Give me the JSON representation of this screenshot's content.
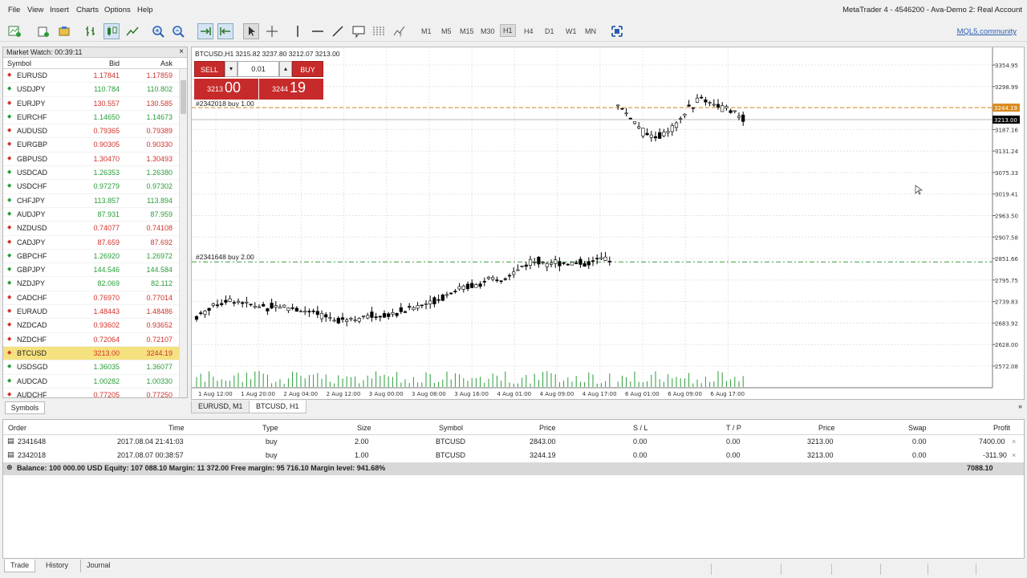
{
  "window_title": "MetaTrader 4 - 4546200 - Ava-Demo 2: Real Account",
  "menu": [
    "File",
    "View",
    "Insert",
    "Charts",
    "Options",
    "Help"
  ],
  "toolbar": {
    "timeframes": [
      "M1",
      "M5",
      "M15",
      "M30",
      "H1",
      "H4",
      "D1",
      "W1",
      "MN"
    ],
    "active_timeframe": "H1",
    "community_link": "MQL5.community"
  },
  "market_watch": {
    "title": "Market Watch: 00:39:11",
    "columns": {
      "symbol": "Symbol",
      "bid": "Bid",
      "ask": "Ask"
    },
    "rows": [
      {
        "symbol": "EURUSD",
        "bid": "1.17841",
        "ask": "1.17859",
        "dir": "down"
      },
      {
        "symbol": "USDJPY",
        "bid": "110.784",
        "ask": "110.802",
        "dir": "up"
      },
      {
        "symbol": "EURJPY",
        "bid": "130.557",
        "ask": "130.585",
        "dir": "down"
      },
      {
        "symbol": "EURCHF",
        "bid": "1.14650",
        "ask": "1.14673",
        "dir": "up"
      },
      {
        "symbol": "AUDUSD",
        "bid": "0.79365",
        "ask": "0.79389",
        "dir": "down"
      },
      {
        "symbol": "EURGBP",
        "bid": "0.90305",
        "ask": "0.90330",
        "dir": "down"
      },
      {
        "symbol": "GBPUSD",
        "bid": "1.30470",
        "ask": "1.30493",
        "dir": "down"
      },
      {
        "symbol": "USDCAD",
        "bid": "1.26353",
        "ask": "1.26380",
        "dir": "up"
      },
      {
        "symbol": "USDCHF",
        "bid": "0.97279",
        "ask": "0.97302",
        "dir": "up"
      },
      {
        "symbol": "CHFJPY",
        "bid": "113.857",
        "ask": "113.894",
        "dir": "up"
      },
      {
        "symbol": "AUDJPY",
        "bid": "87.931",
        "ask": "87.959",
        "dir": "up"
      },
      {
        "symbol": "NZDUSD",
        "bid": "0.74077",
        "ask": "0.74108",
        "dir": "down"
      },
      {
        "symbol": "CADJPY",
        "bid": "87.659",
        "ask": "87.692",
        "dir": "down"
      },
      {
        "symbol": "GBPCHF",
        "bid": "1.26920",
        "ask": "1.26972",
        "dir": "up"
      },
      {
        "symbol": "GBPJPY",
        "bid": "144.546",
        "ask": "144.584",
        "dir": "up"
      },
      {
        "symbol": "NZDJPY",
        "bid": "82.069",
        "ask": "82.112",
        "dir": "up"
      },
      {
        "symbol": "CADCHF",
        "bid": "0.76970",
        "ask": "0.77014",
        "dir": "down"
      },
      {
        "symbol": "EURAUD",
        "bid": "1.48443",
        "ask": "1.48486",
        "dir": "down"
      },
      {
        "symbol": "NZDCAD",
        "bid": "0.93602",
        "ask": "0.93652",
        "dir": "down"
      },
      {
        "symbol": "NZDCHF",
        "bid": "0.72064",
        "ask": "0.72107",
        "dir": "down"
      },
      {
        "symbol": "BTCUSD",
        "bid": "3213.00",
        "ask": "3244.19",
        "dir": "down",
        "selected": true
      },
      {
        "symbol": "USDSGD",
        "bid": "1.36035",
        "ask": "1.36077",
        "dir": "up"
      },
      {
        "symbol": "AUDCAD",
        "bid": "1.00282",
        "ask": "1.00330",
        "dir": "up"
      },
      {
        "symbol": "AUDCHF",
        "bid": "0.77205",
        "ask": "0.77250",
        "dir": "down"
      }
    ],
    "tab": "Symbols"
  },
  "chart": {
    "label": "BTCUSD,H1  3215.82 3237.80 3212.07 3213.00",
    "one_click": {
      "sell": "SELL",
      "buy": "BUY",
      "lot": "0.01",
      "sell_small": "3213",
      "sell_big": "00",
      "buy_small": "3244",
      "buy_big": "19"
    },
    "order_lines": [
      {
        "label": "#2342018 buy 1.00",
        "price": 3244.19
      },
      {
        "label": "#2341648 buy 2.00",
        "price": 2843.0
      }
    ],
    "price_axis": [
      "3354.95",
      "3298.99",
      "3243.03",
      "3187.16",
      "3131.24",
      "3075.33",
      "3019.41",
      "2963.50",
      "2907.58",
      "2851.66",
      "2795.75",
      "2739.83",
      "2683.92",
      "2628.00",
      "2572.08"
    ],
    "ask_tag": "3244.19",
    "bid_tag": "3213.00",
    "time_axis": [
      "1 Aug 12:00",
      "1 Aug 20:00",
      "2 Aug 04:00",
      "2 Aug 12:00",
      "3 Aug 00:00",
      "3 Aug 08:00",
      "3 Aug 16:00",
      "4 Aug 01:00",
      "4 Aug 09:00",
      "4 Aug 17:00",
      "6 Aug 01:00",
      "6 Aug 09:00",
      "6 Aug 17:00"
    ],
    "tabs": [
      "EURUSD, M1",
      "BTCUSD, H1"
    ],
    "active_tab": "BTCUSD, H1"
  },
  "terminal": {
    "columns": [
      "Order",
      "Time",
      "Type",
      "Size",
      "Symbol",
      "Price",
      "S / L",
      "T / P",
      "Price",
      "Swap",
      "Profit"
    ],
    "rows": [
      {
        "order": "2341648",
        "time": "2017.08.04 21:41:03",
        "type": "buy",
        "size": "2.00",
        "symbol": "BTCUSD",
        "price": "2843.00",
        "sl": "0.00",
        "tp": "0.00",
        "cur": "3213.00",
        "swap": "0.00",
        "profit": "7400.00"
      },
      {
        "order": "2342018",
        "time": "2017.08.07 00:38:57",
        "type": "buy",
        "size": "1.00",
        "symbol": "BTCUSD",
        "price": "3244.19",
        "sl": "0.00",
        "tp": "0.00",
        "cur": "3213.00",
        "swap": "0.00",
        "profit": "-311.90"
      }
    ],
    "balance_text": "Balance: 100 000.00 USD  Equity: 107 088.10  Margin: 11 372.00  Free margin: 95 716.10  Margin level: 941.68%",
    "balance_profit": "7088.10",
    "tabs": [
      "Trade",
      "History",
      "Journal"
    ],
    "active_tab": "Trade"
  },
  "colors": {
    "up": "#2a9d3a",
    "down": "#d0332c",
    "sell_buy": "#c72a2a",
    "selected_row": "#f6e17f",
    "order_line_1": "#d98b1f",
    "order_line_2": "#3a9a3a"
  }
}
